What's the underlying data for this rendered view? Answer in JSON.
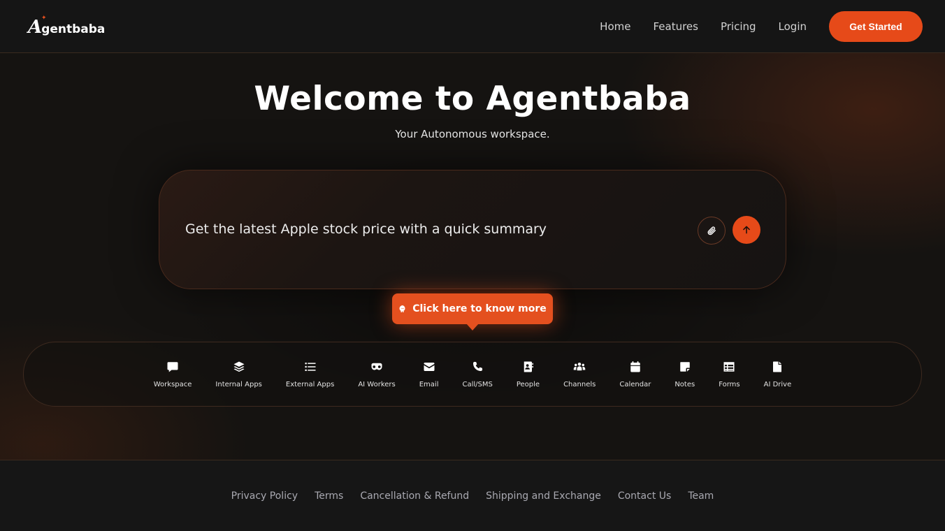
{
  "brand": {
    "logo_initial": "A",
    "logo_rest": "gentbaba"
  },
  "nav": {
    "items": [
      {
        "label": "Home"
      },
      {
        "label": "Features"
      },
      {
        "label": "Pricing"
      },
      {
        "label": "Login"
      }
    ],
    "cta_label": "Get Started"
  },
  "hero": {
    "title": "Welcome to Agentbaba",
    "subtitle": "Your Autonomous workspace."
  },
  "prompt": {
    "text": "Get the latest Apple stock price with a quick summary",
    "attach_icon": "paperclip-icon",
    "send_icon": "arrow-up-icon"
  },
  "tooltip": {
    "label": "Click here to know more",
    "icon": "brain-icon"
  },
  "apps": [
    {
      "label": "Workspace",
      "icon": "chat-bubble-icon"
    },
    {
      "label": "Internal Apps",
      "icon": "layers-icon"
    },
    {
      "label": "External Apps",
      "icon": "list-icon"
    },
    {
      "label": "AI Workers",
      "icon": "mask-icon"
    },
    {
      "label": "Email",
      "icon": "envelope-icon"
    },
    {
      "label": "Call/SMS",
      "icon": "phone-icon"
    },
    {
      "label": "People",
      "icon": "contact-book-icon"
    },
    {
      "label": "Channels",
      "icon": "users-icon"
    },
    {
      "label": "Calendar",
      "icon": "calendar-icon"
    },
    {
      "label": "Notes",
      "icon": "sticky-note-icon"
    },
    {
      "label": "Forms",
      "icon": "table-icon"
    },
    {
      "label": "AI Drive",
      "icon": "file-icon"
    }
  ],
  "footer": {
    "links": [
      {
        "label": "Privacy Policy"
      },
      {
        "label": "Terms"
      },
      {
        "label": "Cancellation & Refund"
      },
      {
        "label": "Shipping and Exchange"
      },
      {
        "label": "Contact Us"
      },
      {
        "label": "Team"
      }
    ]
  },
  "colors": {
    "accent": "#e64a19",
    "background": "#141414",
    "border": "#3a2a1f"
  }
}
